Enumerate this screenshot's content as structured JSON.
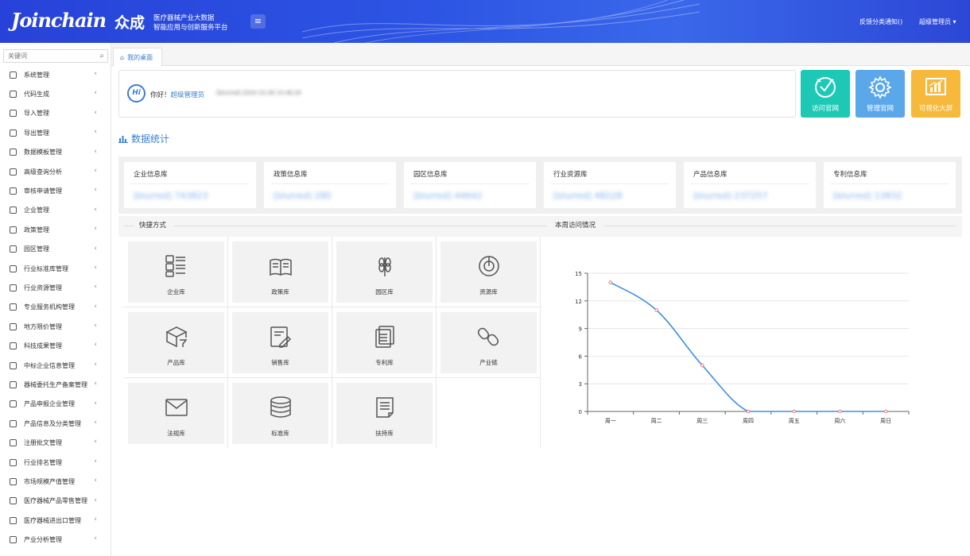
{
  "header": {
    "logo_text": "Joinchain",
    "logo_cn": "众成",
    "subtitle_line1": "医疗器械产业大数据",
    "subtitle_line2": "智能应用与创新服务平台",
    "feedback": "反馈分类通知()",
    "user_menu": "超级管理员 ▾"
  },
  "sidebar": {
    "search_placeholder": "关键词",
    "items": [
      "系统管理",
      "代码生成",
      "导入管理",
      "导出管理",
      "数据模板管理",
      "高级查询分析",
      "审核申请管理",
      "企业管理",
      "政策管理",
      "园区管理",
      "行业标准库管理",
      "行业资源管理",
      "专业服务机构管理",
      "地方限价管理",
      "科技成果管理",
      "中标企业信息管理",
      "器械委托生产备案管理",
      "产品申报企业管理",
      "产品信息及分类管理",
      "注册批文管理",
      "行业排名管理",
      "市场规模产值管理",
      "医疗器械产品零售管理",
      "医疗器械进出口管理",
      "产业分析管理"
    ]
  },
  "tabs": {
    "desktop": "我的桌面"
  },
  "welcome": {
    "hi_text": "Hi",
    "greeting": "你好！",
    "username": "超级管理员",
    "last_login": "[blurred] 2024-10-26 15:46:35"
  },
  "quick_buttons": [
    {
      "label": "访问官网",
      "color": "#1dc9b4"
    },
    {
      "label": "管理官网",
      "color": "#5aa7ea"
    },
    {
      "label": "可视化大屏",
      "color": "#f6b93b"
    }
  ],
  "stats": {
    "title": "数据统计",
    "cards": [
      {
        "label": "企业信息库",
        "value": "[blurred] 743823"
      },
      {
        "label": "政策信息库",
        "value": "[blurred] 280"
      },
      {
        "label": "园区信息库",
        "value": "[blurred] 44642"
      },
      {
        "label": "行业资源库",
        "value": "[blurred] 48228"
      },
      {
        "label": "产品信息库",
        "value": "[blurred] 237257"
      },
      {
        "label": "专利信息库",
        "value": "[blurred] 13832"
      }
    ]
  },
  "shortcuts": {
    "title": "快捷方式",
    "items": [
      {
        "label": "企业库",
        "icon": "list-icon"
      },
      {
        "label": "政策库",
        "icon": "book-icon"
      },
      {
        "label": "园区库",
        "icon": "wheat-icon"
      },
      {
        "label": "资源库",
        "icon": "target-icon"
      },
      {
        "label": "产品库",
        "icon": "box-icon"
      },
      {
        "label": "销售库",
        "icon": "edit-doc-icon"
      },
      {
        "label": "专利库",
        "icon": "documents-icon"
      },
      {
        "label": "产业链",
        "icon": "link-icon"
      },
      {
        "label": "法规库",
        "icon": "envelope-icon"
      },
      {
        "label": "标准库",
        "icon": "database-icon"
      },
      {
        "label": "扶持库",
        "icon": "notes-icon"
      }
    ]
  },
  "visits": {
    "title": "本周访问情况"
  },
  "chart_data": {
    "type": "line",
    "categories": [
      "周一",
      "周二",
      "周三",
      "周四",
      "周五",
      "周六",
      "周日"
    ],
    "series": [
      {
        "values": [
          14,
          11,
          5,
          0,
          0,
          0,
          0
        ]
      }
    ],
    "ylim": [
      0,
      15
    ],
    "yticks": [
      0,
      3,
      6,
      9,
      12,
      15
    ],
    "grid": true,
    "colors": {
      "line": "#3d8fe6",
      "point": "#e07878"
    }
  }
}
